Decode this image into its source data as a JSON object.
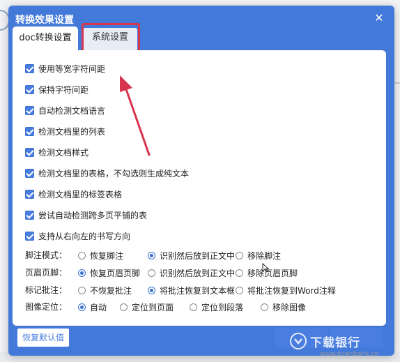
{
  "dialog": {
    "title": "转换效果设置",
    "tabs": [
      {
        "label": "doc转换设置",
        "active": true
      },
      {
        "label": "系统设置",
        "active": false
      }
    ]
  },
  "checkboxes": [
    {
      "label": "使用等宽字符间距",
      "checked": true
    },
    {
      "label": "保持字符间距",
      "checked": true
    },
    {
      "label": "自动检测文档语言",
      "checked": true
    },
    {
      "label": "检测文档里的列表",
      "checked": true
    },
    {
      "label": "检测文档样式",
      "checked": true
    },
    {
      "label": "检测文档里的表格，不勾选则生成纯文本",
      "checked": true
    },
    {
      "label": "检测文档里的标签表格",
      "checked": true
    },
    {
      "label": "尝试自动检测跨多页平铺的表",
      "checked": true
    },
    {
      "label": "支持从右向左的书写方向",
      "checked": true
    }
  ],
  "options": {
    "footnote": {
      "label": "脚注模式：",
      "choices": [
        "恢复脚注",
        "识别然后放到正文中",
        "移除脚注"
      ],
      "selected": "识别然后放到正文中"
    },
    "header_footer": {
      "label": "页眉页脚：",
      "choices": [
        "恢复页眉页脚",
        "识别然后放到正文中",
        "移除页眉页脚"
      ],
      "selected": "恢复页眉页脚"
    },
    "annotation": {
      "label": "标记批注：",
      "choices": [
        "不恢复批注",
        "将批注恢复到文本框",
        "将批注恢复到Word注释"
      ],
      "selected": "将批注恢复到文本框"
    },
    "image_position": {
      "label": "图像定位：",
      "choices": [
        "自动",
        "定位到页面",
        "定位到段落",
        "移除图像"
      ],
      "selected": "自动"
    }
  },
  "buttons": {
    "reset": "恢复默认值"
  },
  "watermark": {
    "text": "下载银行",
    "url": "www.downbank.cn"
  },
  "colors": {
    "dialog_header": "#4379d9",
    "accent": "#4a7de0",
    "highlight": "#d9344d"
  }
}
